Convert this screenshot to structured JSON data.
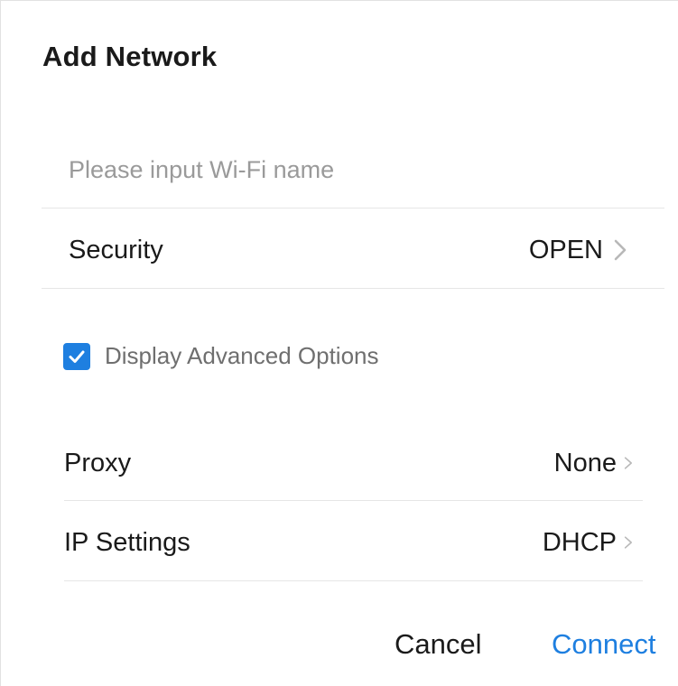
{
  "dialog": {
    "title": "Add Network"
  },
  "ssid": {
    "placeholder": "Please input Wi-Fi name",
    "value": ""
  },
  "security": {
    "label": "Security",
    "value": "OPEN"
  },
  "advanced": {
    "label": "Display Advanced Options",
    "checked": true
  },
  "proxy": {
    "label": "Proxy",
    "value": "None"
  },
  "ip_settings": {
    "label": "IP Settings",
    "value": "DHCP"
  },
  "actions": {
    "cancel_label": "Cancel",
    "connect_label": "Connect"
  },
  "colors": {
    "accent": "#1e7fe0",
    "divider": "#e6e6e6",
    "muted_text": "#6f6f6f"
  },
  "icons": {
    "chevron": "chevron-right-icon",
    "check": "checkmark-icon"
  }
}
